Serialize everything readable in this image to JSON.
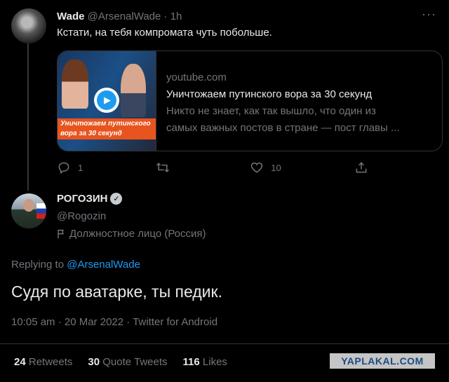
{
  "tweet1": {
    "name": "Wade",
    "handle": "@ArsenalWade",
    "separator": "·",
    "time": "1h",
    "more": "···",
    "text": "Кстати, на тебя компромата чуть побольше.",
    "card": {
      "banner": "Уничтожаем путинского вора за 30 секунд",
      "domain": "youtube.com",
      "title": "Уничтожаем путинского вора за 30 секунд",
      "desc_line1": "Никто не знает, как так вышло, что один из",
      "desc_line2": "самых важных постов в стране — пост главы ..."
    },
    "actions": {
      "replies": "1",
      "retweets": "",
      "likes": "10"
    }
  },
  "tweet2": {
    "name": "РОГОЗИН",
    "handle": "@Rogozin",
    "label": "Должностное лицо (Россия)",
    "replying_prefix": "Replying to",
    "replying_to": "@ArsenalWade",
    "text": "Судя по аватарке, ты педик.",
    "meta": "10:05 am · 20 Mar 2022 · Twitter for Android",
    "stats": {
      "retweets_count": "24",
      "retweets_label": "Retweets",
      "quotes_count": "30",
      "quotes_label": "Quote Tweets",
      "likes_count": "116",
      "likes_label": "Likes"
    }
  },
  "watermark": "YAPLAKAL.COM",
  "colors": {
    "background": "#000000",
    "accent": "#1d9bf0",
    "muted": "#71767b",
    "text": "#e7e9ea"
  }
}
